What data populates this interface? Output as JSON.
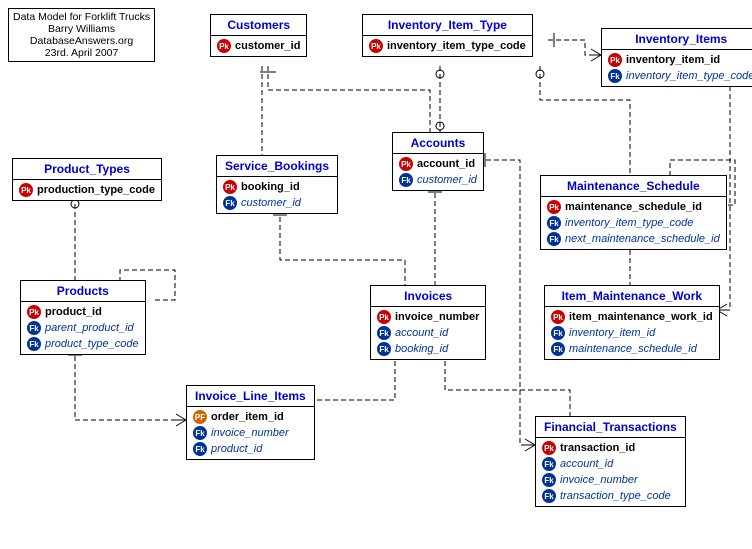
{
  "info": {
    "line1": "Data Model for Forklift Trucks",
    "line2": "Barry Williams",
    "line3": "DatabaseAnswers.org",
    "line4": "23rd. April  2007"
  },
  "entities": {
    "customers": {
      "title": "Customers",
      "pk": "customer_id"
    },
    "inventory_item_type": {
      "title": "Inventory_Item_Type",
      "pk": "inventory_item_type_code"
    },
    "inventory_items": {
      "title": "Inventory_Items",
      "pk": "inventory_item_id",
      "fk1": "inventory_item_type_code"
    },
    "product_types": {
      "title": "Product_Types",
      "pk": "production_type_code"
    },
    "service_bookings": {
      "title": "Service_Bookings",
      "pk": "booking_id",
      "fk1": "customer_id"
    },
    "accounts": {
      "title": "Accounts",
      "pk": "account_id",
      "fk1": "customer_id"
    },
    "maintenance_schedule": {
      "title": "Maintenance_Schedule",
      "pk": "maintenance_schedule_id",
      "fk1": "inventory_item_type_code",
      "fk2": "next_maintenance_schedule_id"
    },
    "invoices": {
      "title": "Invoices",
      "pk": "invoice_number",
      "fk1": "account_id",
      "fk2": "booking_id"
    },
    "products": {
      "title": "Products",
      "pk": "product_id",
      "fk1": "parent_product_id",
      "fk2": "product_type_code"
    },
    "item_maintenance_work": {
      "title": "Item_Maintenance_Work",
      "pk": "item_maintenance_work_id",
      "fk1": "inventory_item_id",
      "fk2": "maintenance_schedule_id"
    },
    "invoice_line_items": {
      "title": "Invoice_Line_Items",
      "pf": "order_item_id",
      "fk1": "invoice_number",
      "fk2": "product_id"
    },
    "financial_transactions": {
      "title": "Financial_Transactions",
      "pk": "transaction_id",
      "fk1": "account_id",
      "fk2": "invoice_number",
      "fk3": "transaction_type_code"
    }
  },
  "badges": {
    "pk": "Pk",
    "fk": "Fk",
    "pf": "PF"
  }
}
